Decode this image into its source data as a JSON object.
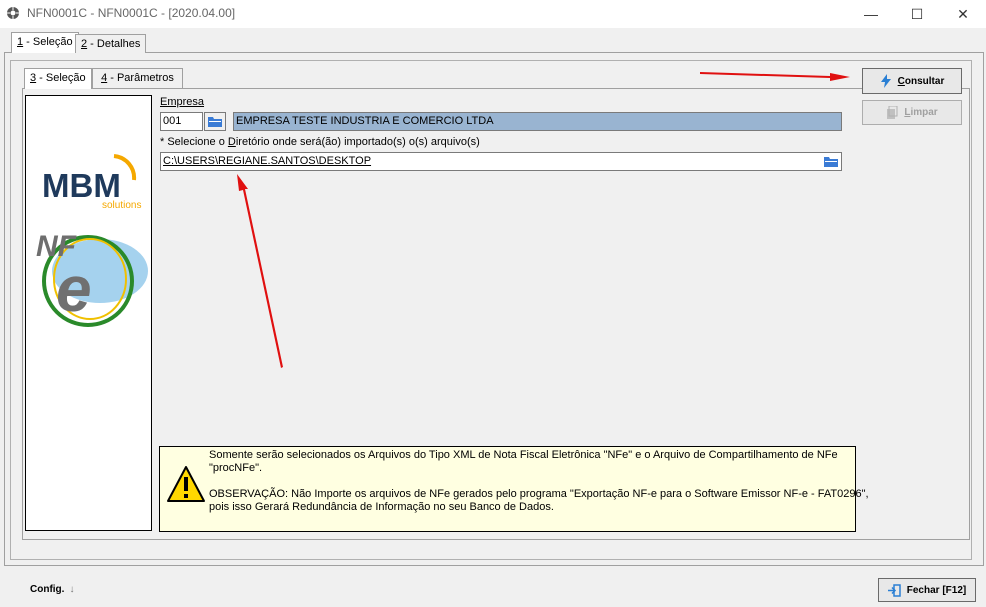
{
  "window": {
    "title": "NFN0001C - NFN0001C - [2020.04.00]",
    "minimize": "—",
    "maximize": "☐",
    "close": "✕"
  },
  "outer_tabs": [
    {
      "key": "1",
      "label": " - Seleção"
    },
    {
      "key": "2",
      "label": " - Detalhes"
    }
  ],
  "inner_tabs": [
    {
      "key": "3",
      "label": " - Seleção"
    },
    {
      "key": "4",
      "label": " - Parâmetros"
    }
  ],
  "form": {
    "empresa_label": "Empresa",
    "empresa_code": "001",
    "empresa_name": "EMPRESA TESTE INDUSTRIA E COMERCIO LTDA",
    "dir_label_prefix": "* Selecione o ",
    "dir_label_key": "D",
    "dir_label_rest": "iretório onde será(ão) importado(s) o(s) arquivo(s)",
    "dir_value": "C:\\USERS\\REGIANE.SANTOS\\DESKTOP"
  },
  "buttons": {
    "consultar_key": "C",
    "consultar_rest": "onsultar",
    "limpar_key": "L",
    "limpar_rest": "impar",
    "fechar": "Fechar [F12]"
  },
  "logo": {
    "brand": "MBM",
    "sub": "solutions",
    "nfe_nf": "NF",
    "nfe_e": "e"
  },
  "warning": {
    "line1": "Somente serão selecionados os Arquivos do Tipo XML de Nota Fiscal Eletrônica \"NFe\" e o Arquivo de Compartilhamento de NFe",
    "line2": "\"procNFe\".",
    "line3": "OBSERVAÇÃO: Não Importe os arquivos de NFe gerados pelo  programa \"Exportação NF-e para o Software Emissor NF-e - FAT0296\",",
    "line4": "pois isso Gerará Redundância de Informação no seu Banco de Dados."
  },
  "bottom": {
    "config": "Config."
  },
  "colors": {
    "selection_blue": "#99b4d1",
    "warning_bg": "#ffffe1",
    "arrow_red": "#e01010"
  }
}
